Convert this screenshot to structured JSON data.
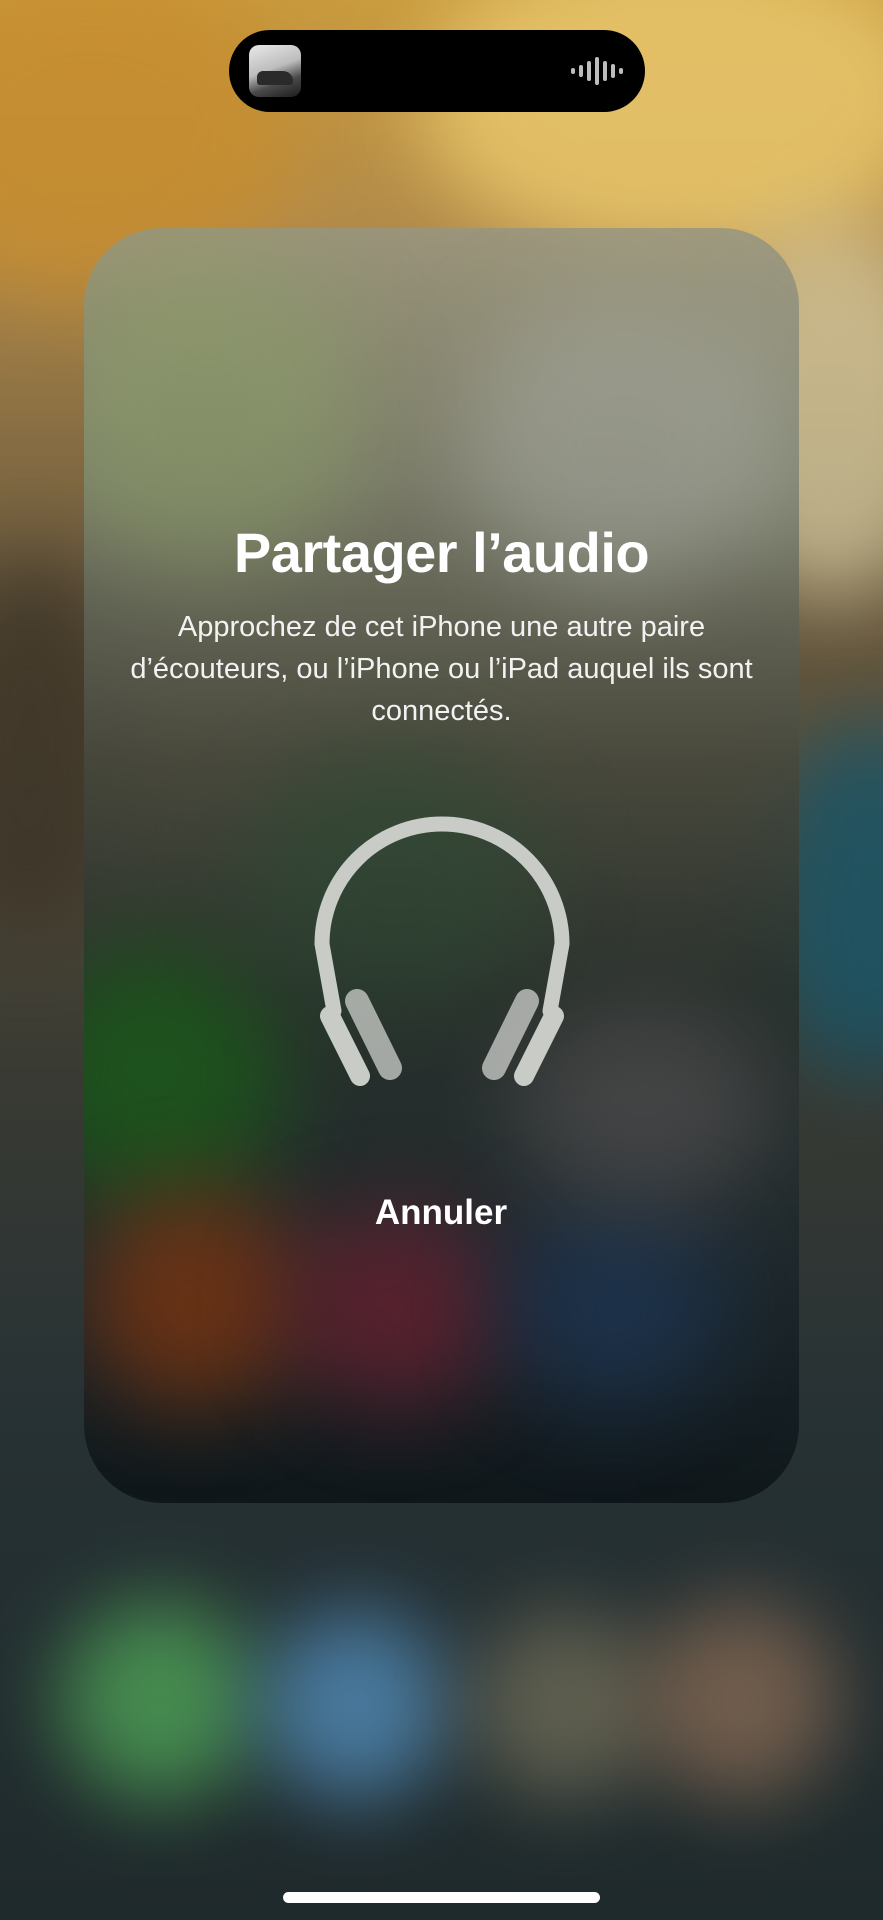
{
  "dynamic_island": {
    "now_playing_icon": "album-artwork",
    "activity_icon": "waveform-icon"
  },
  "share_audio_sheet": {
    "title": "Partager l’audio",
    "description": "Approchez de cet iPhone une autre paire d’écouteurs, ou l’iPhone ou l’iPad auquel ils sont connectés.",
    "illustration_icon": "headphones-icon",
    "cancel_label": "Annuler"
  },
  "colors": {
    "text": "#ffffff",
    "headphones": "#c8cbc6"
  }
}
